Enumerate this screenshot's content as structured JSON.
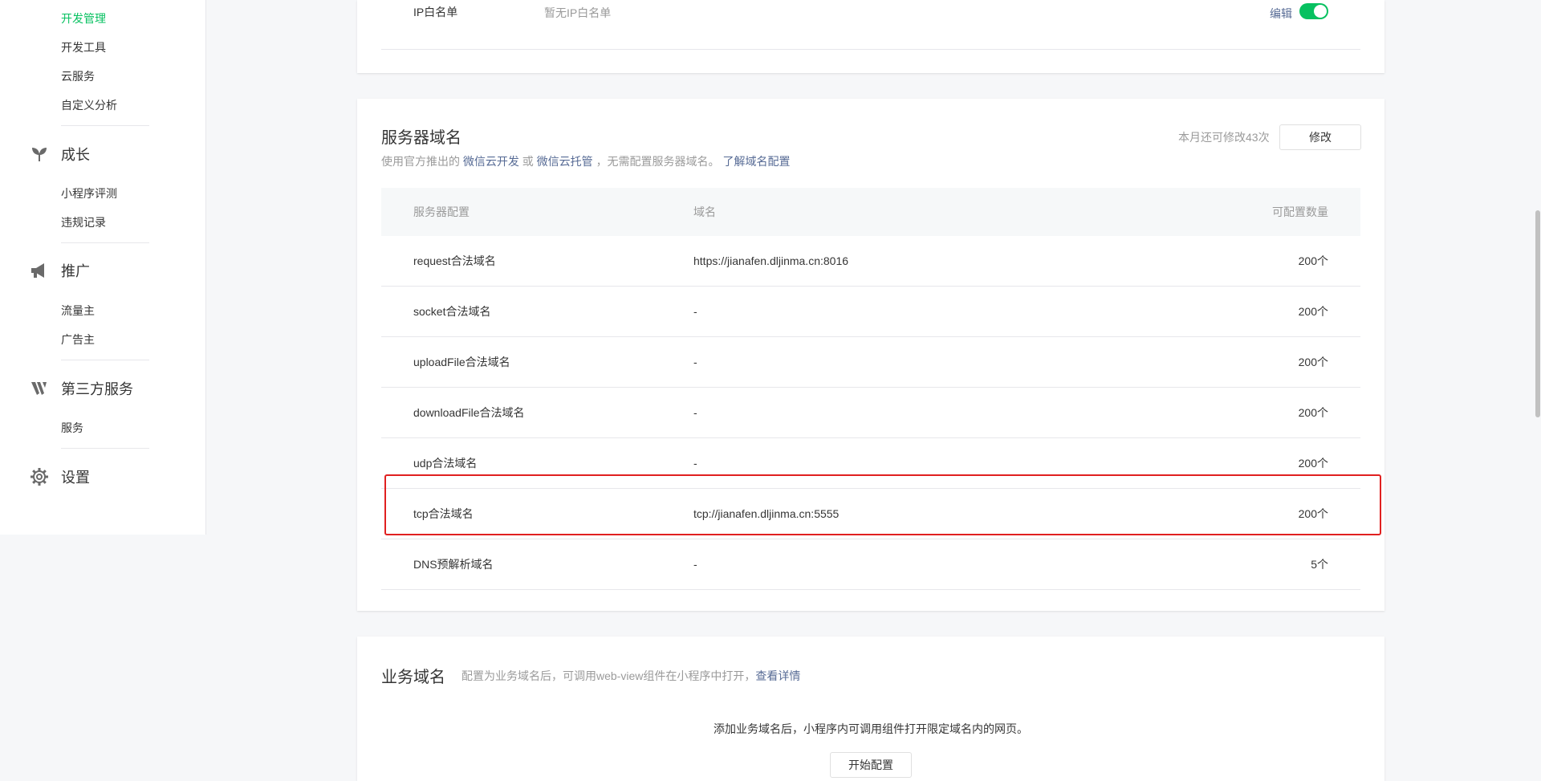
{
  "sidebar": {
    "dev_items": [
      {
        "label": "开发管理",
        "active": true
      },
      {
        "label": "开发工具",
        "active": false
      },
      {
        "label": "云服务",
        "active": false
      },
      {
        "label": "自定义分析",
        "active": false
      }
    ],
    "growth": {
      "label": "成长",
      "icon": "sprout-icon",
      "items": [
        "小程序评测",
        "违规记录"
      ]
    },
    "promotion": {
      "label": "推广",
      "icon": "megaphone-icon",
      "items": [
        "流量主",
        "广告主"
      ]
    },
    "third_party": {
      "label": "第三方服务",
      "icon": "third-party-logo-icon",
      "items": [
        "服务"
      ]
    },
    "settings": {
      "label": "设置",
      "icon": "gear-icon"
    },
    "active_color": "#07c160"
  },
  "ip_whitelist": {
    "label": "IP白名单",
    "value": "暂无IP白名单",
    "edit_label": "编辑",
    "toggle_on": true
  },
  "server_domain": {
    "title": "服务器域名",
    "desc_prefix": "使用官方推出的",
    "link1": "微信云开发",
    "or_text": "或",
    "link2": "微信云托管",
    "desc_suffix": "，无需配置服务器域名。",
    "link3": "了解域名配置",
    "quota_text": "本月还可修改43次",
    "modify_label": "修改",
    "table": {
      "headers": {
        "config": "服务器配置",
        "domain": "域名",
        "count": "可配置数量"
      },
      "rows": [
        {
          "name": "request合法域名",
          "domain": "https://jianafen.dljinma.cn:8016",
          "count": "200个"
        },
        {
          "name": "socket合法域名",
          "domain": "-",
          "count": "200个"
        },
        {
          "name": "uploadFile合法域名",
          "domain": "-",
          "count": "200个"
        },
        {
          "name": "downloadFile合法域名",
          "domain": "-",
          "count": "200个"
        },
        {
          "name": "udp合法域名",
          "domain": "-",
          "count": "200个"
        },
        {
          "name": "tcp合法域名",
          "domain": "tcp://jianafen.dljinma.cn:5555",
          "count": "200个"
        },
        {
          "name": "DNS预解析域名",
          "domain": "-",
          "count": "5个"
        }
      ]
    },
    "highlight_color": "#e02020"
  },
  "business_domain": {
    "title": "业务域名",
    "desc": "配置为业务域名后，可调用web-view组件在小程序中打开，",
    "desc_link": "查看详情",
    "empty_text": "添加业务域名后，小程序内可调用组件打开限定域名内的网页。",
    "start_label": "开始配置"
  },
  "colors": {
    "link": "#576b95",
    "accent": "#07c160",
    "muted": "#9a9a9a"
  }
}
